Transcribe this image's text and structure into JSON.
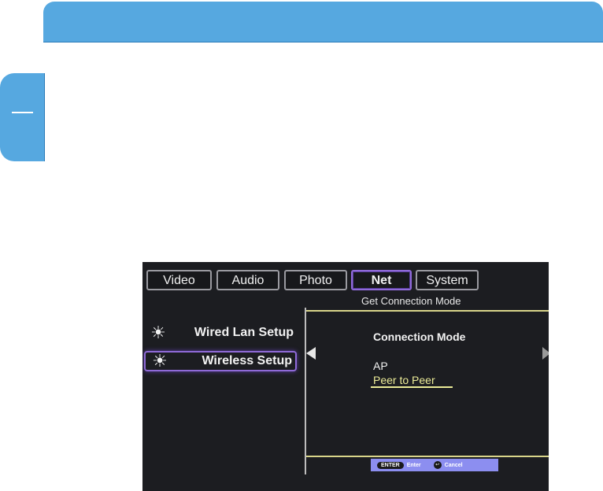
{
  "tabs": [
    {
      "label": "Video"
    },
    {
      "label": "Audio"
    },
    {
      "label": "Photo"
    },
    {
      "label": "Net"
    },
    {
      "label": "System"
    }
  ],
  "panel": {
    "title": "Get Connection Mode",
    "connection_label": "Connection Mode",
    "options": [
      "AP",
      "Peer to Peer"
    ],
    "selected_option": "Peer to Peer"
  },
  "menu": {
    "items": [
      {
        "label": "Wired Lan Setup",
        "icon": "sun-icon"
      },
      {
        "label": "Wireless Setup",
        "icon": "sun-icon",
        "selected": true
      }
    ]
  },
  "hints": {
    "enter_key": "ENTER",
    "enter_label": "Enter",
    "cancel_label": "Cancel"
  },
  "colors": {
    "banner": "#56a8e0",
    "selection": "#8f6ad8",
    "highlight_text": "#ecec98",
    "hint_bar": "#8c8ef0"
  }
}
